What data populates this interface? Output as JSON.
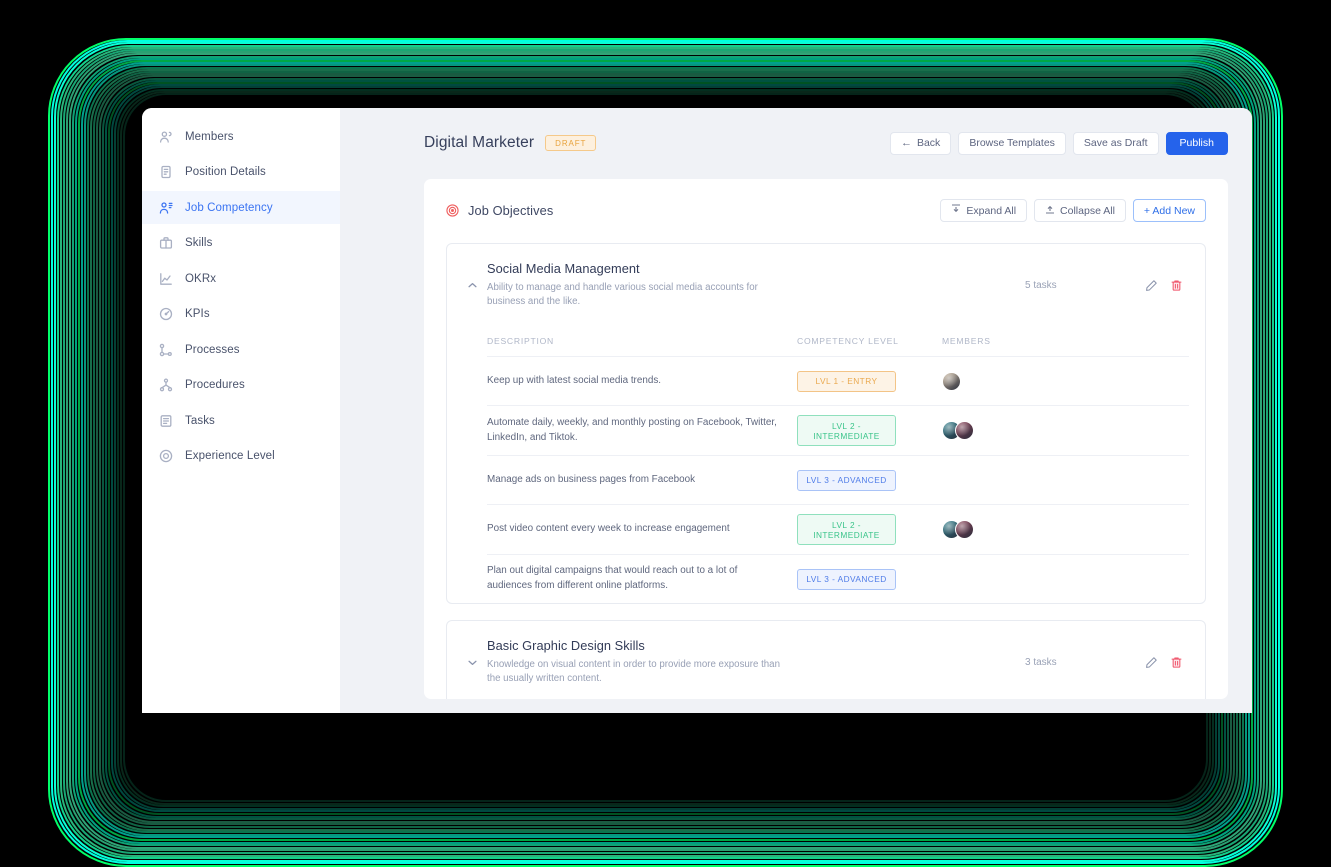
{
  "frame": {
    "colors": [
      "#00ff6a",
      "#00ffe0",
      "#0affd5",
      "#13d08c",
      "#2fd18e",
      "#1ec98b",
      "#35c98f",
      "#3fd79c",
      "#16e0a0",
      "#00e7b8"
    ],
    "background": "#000000"
  },
  "sidebar": {
    "items": [
      {
        "label": "Members",
        "icon": "members-icon",
        "active": false
      },
      {
        "label": "Position Details",
        "icon": "document-icon",
        "active": false
      },
      {
        "label": "Job Competency",
        "icon": "competency-icon",
        "active": true
      },
      {
        "label": "Skills",
        "icon": "briefcase-icon",
        "active": false
      },
      {
        "label": "OKRx",
        "icon": "chart-line-icon",
        "active": false
      },
      {
        "label": "KPIs",
        "icon": "gauge-icon",
        "active": false
      },
      {
        "label": "Processes",
        "icon": "flow-icon",
        "active": false
      },
      {
        "label": "Procedures",
        "icon": "hierarchy-icon",
        "active": false
      },
      {
        "label": "Tasks",
        "icon": "list-icon",
        "active": false
      },
      {
        "label": "Experience Level",
        "icon": "target-circle-icon",
        "active": false
      }
    ]
  },
  "topbar": {
    "title": "Digital Marketer",
    "status_badge": "DRAFT",
    "status_badge_color": "#e8a33d",
    "back_label": "Back",
    "back_icon": "arrow-left-icon",
    "browse_templates_label": "Browse Templates",
    "save_draft_label": "Save as Draft",
    "publish_label": "Publish",
    "publish_color": "#2563eb"
  },
  "panel": {
    "title": "Job Objectives",
    "title_icon": "target-icon",
    "title_icon_color": "#ef5f5f",
    "expand_all_label": "Expand All",
    "expand_all_icon": "expand-icon",
    "collapse_all_label": "Collapse All",
    "collapse_all_icon": "collapse-icon",
    "add_new_label": "+ Add New"
  },
  "table_headers": {
    "description": "DESCRIPTION",
    "competency_level": "COMPETENCY LEVEL",
    "members": "MEMBERS"
  },
  "objectives": [
    {
      "name": "Social Media Management",
      "description": "Ability to manage and handle various social media accounts for business and the like.",
      "task_count": "5 tasks",
      "expanded": true,
      "chevron": "chevron-up-icon",
      "edit_icon": "pencil-icon",
      "delete_icon": "trash-icon",
      "rows": [
        {
          "description": "Keep up with latest social media trends.",
          "level": "LVL 1 - ENTRY",
          "level_class": "lvl-1",
          "members": [
            "#c8b49a"
          ]
        },
        {
          "description": "Automate daily, weekly, and monthly posting on Facebook, Twitter, LinkedIn, and Tiktok.",
          "level": "LVL 2 - INTERMEDIATE",
          "level_class": "lvl-2",
          "members": [
            "#2b7f8c",
            "#8e3f55"
          ]
        },
        {
          "description": "Manage ads on business pages from Facebook",
          "level": "LVL 3 - ADVANCED",
          "level_class": "lvl-3",
          "members": []
        },
        {
          "description": "Post video content every week to increase engagement",
          "level": "LVL 2 - INTERMEDIATE",
          "level_class": "lvl-2",
          "members": [
            "#2b7f8c",
            "#8e3f55"
          ]
        },
        {
          "description": "Plan out digital campaigns that would reach out to a lot of audiences from different online platforms.",
          "level": "LVL 3 - ADVANCED",
          "level_class": "lvl-3",
          "members": []
        }
      ]
    },
    {
      "name": "Basic Graphic Design Skills",
      "description": "Knowledge on visual content in order to provide more exposure than the usually written content.",
      "task_count": "3 tasks",
      "expanded": false,
      "chevron": "chevron-down-icon",
      "edit_icon": "pencil-icon",
      "delete_icon": "trash-icon",
      "rows": []
    }
  ]
}
